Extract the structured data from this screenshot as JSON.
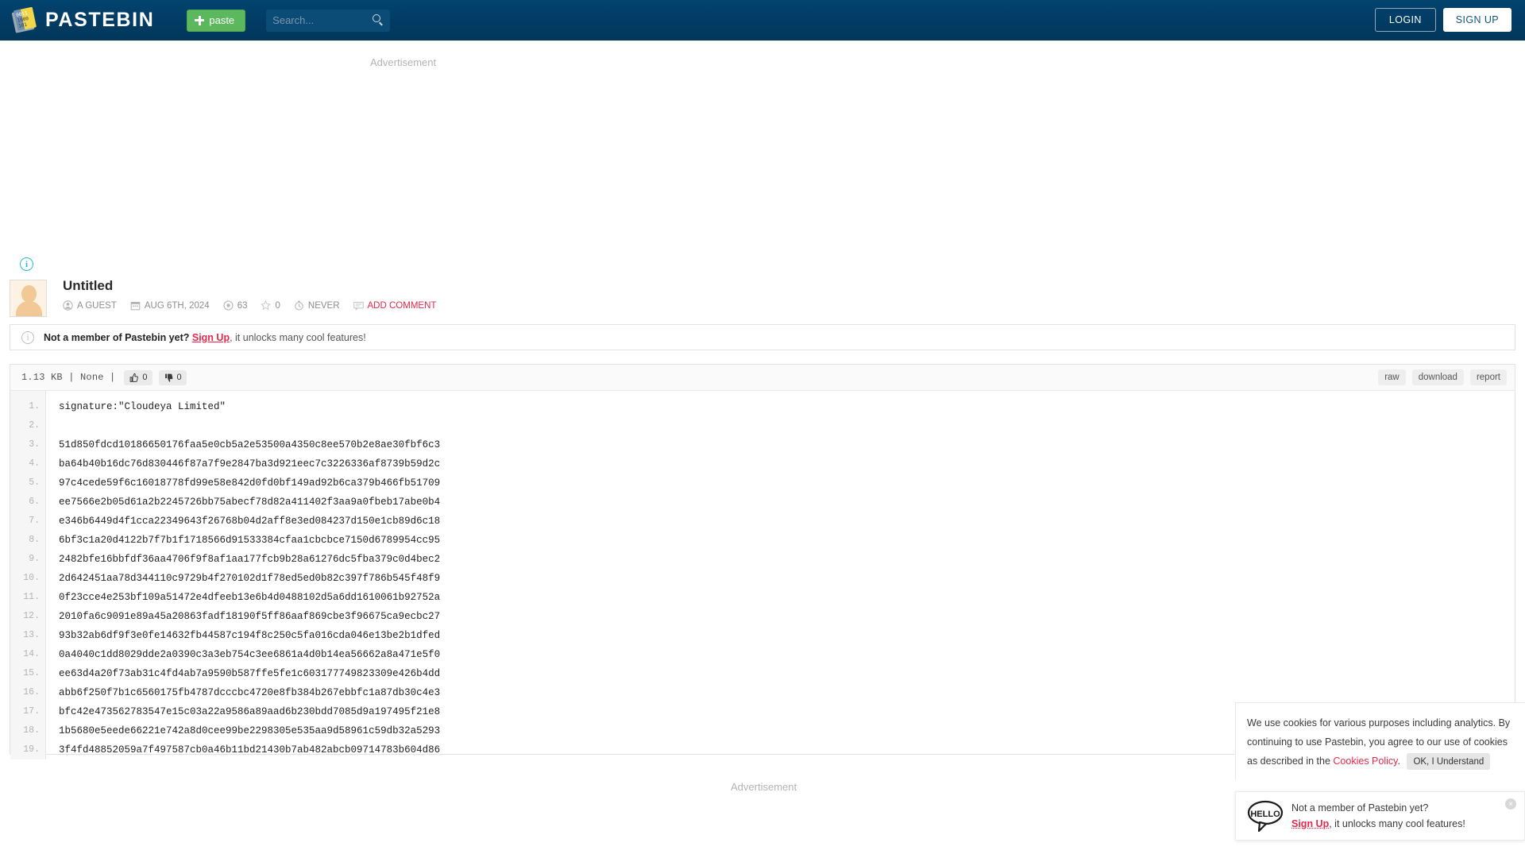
{
  "header": {
    "logo_text": "PASTEBIN",
    "paste_button": "paste",
    "search_placeholder": "Search...",
    "login_label": "LOGIN",
    "signup_label": "SIGN UP",
    "brand_bg": "#023b62",
    "paste_green": "#5cb85c"
  },
  "ads": {
    "top_label": "Advertisement",
    "bottom_label": "Advertisement"
  },
  "info_icon_char": "i",
  "paste": {
    "title": "Untitled",
    "author": "A GUEST",
    "date": "AUG 6TH, 2024",
    "views": "63",
    "stars": "0",
    "expiry": "NEVER",
    "add_comment": "ADD COMMENT"
  },
  "notice": {
    "bold_text": "Not a member of Pastebin yet?",
    "link_text": "Sign Up",
    "rest_text": ", it unlocks many cool features!"
  },
  "toolbar": {
    "size_text": "1.13 KB  |  None  |",
    "likes": "0",
    "dislikes": "0",
    "raw_label": "raw",
    "download_label": "download",
    "report_label": "report"
  },
  "code": {
    "line_numbers": [
      "1.",
      "2.",
      "3.",
      "4.",
      "5.",
      "6.",
      "7.",
      "8.",
      "9.",
      "10.",
      "11.",
      "12.",
      "13.",
      "14.",
      "15.",
      "16.",
      "17.",
      "18.",
      "19."
    ],
    "lines": [
      "signature:\"Cloudeya Limited\"",
      "",
      "51d850fdcd10186650176faa5e0cb5a2e53500a4350c8ee570b2e8ae30fbf6c3",
      "ba64b40b16dc76d830446f87a7f9e2847ba3d921eec7c3226336af8739b59d2c",
      "97c4cede59f6c16018778fd99e58e842d0fd0bf149ad92b6ca379b466fb51709",
      "ee7566e2b05d61a2b2245726bb75abecf78d82a411402f3aa9a0fbeb17abe0b4",
      "e346b6449d4f1cca22349643f26768b04d2aff8e3ed084237d150e1cb89d6c18",
      "6bf3c1a20d4122b7f7b1f1718566d91533384cfaa1cbcbce7150d6789954cc95",
      "2482bfe16bbfdf36aa4706f9f8af1aa177fcb9b28a61276dc5fba379c0d4bec2",
      "2d642451aa78d344110c9729b4f270102d1f78ed5ed0b82c397f786b545f48f9",
      "0f23cce4e253bf109a51472e4dfeeb13e6b4d0488102d5a6dd1610061b92752a",
      "2010fa6c9091e89a45a20863fadf18190f5ff86aaf869cbe3f96675ca9ecbc27",
      "93b32ab6df9f3e0fe14632fb44587c194f8c250c5fa016cda046e13be2b1dfed",
      "0a4040c1dd8029dde2a0390c3a3eb754c3ee6861a4d0b14ea56662a8a471e5f0",
      "ee63d4a20f73ab31c4fd4ab7a9590b587ffe5fe1c603177749823309e426b4dd",
      "abb6f250f7b1c6560175fb4787dcccbc4720e8fb384b267ebbfc1a87db30c4e3",
      "bfc42e473562783547e15c03a22a9586a89aad6b230bdd7085d9a197495f21e8",
      "1b5680e5eede66221e742a8d0cee99be2298305e535aa9d58961c59db32a5293",
      "3f4fd48852059a7f497587cb0a46b11bd21430b7ab482abcb09714783b604d86"
    ]
  },
  "cookie": {
    "text_part1": "We use cookies for various purposes including analytics. By continuing to use Pastebin, you agree to our use of cookies as described in the ",
    "policy_link": "Cookies Policy",
    "text_part2": ".",
    "ok_label": "OK, I Understand"
  },
  "hello": {
    "bubble_text": "HELLO",
    "line1": "Not a member of Pastebin yet?",
    "link": "Sign Up",
    "line2_rest": ", it unlocks many cool features!",
    "close_char": "×"
  }
}
